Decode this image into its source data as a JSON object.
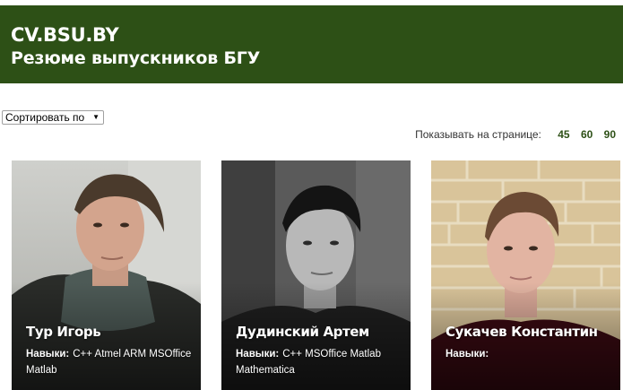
{
  "header": {
    "site_name": "CV.BSU.BY",
    "subtitle": "Резюме выпускников БГУ",
    "background": "#2d5016"
  },
  "sort": {
    "label": "Сортировать по"
  },
  "per_page": {
    "label": "Показывать на странице:",
    "options": [
      "45",
      "60",
      "90"
    ]
  },
  "cards": [
    {
      "name": "Тур Игорь",
      "skills_label": "Навыки:",
      "skills": "C++  Atmel ARM MSOffice  Matlab"
    },
    {
      "name": "Дудинский  Артем",
      "skills_label": "Навыки:",
      "skills": "C++ MSOffice Matlab  Mathematica"
    },
    {
      "name": "Сукачев  Константин",
      "skills_label": "Навыки:",
      "skills": ""
    }
  ]
}
